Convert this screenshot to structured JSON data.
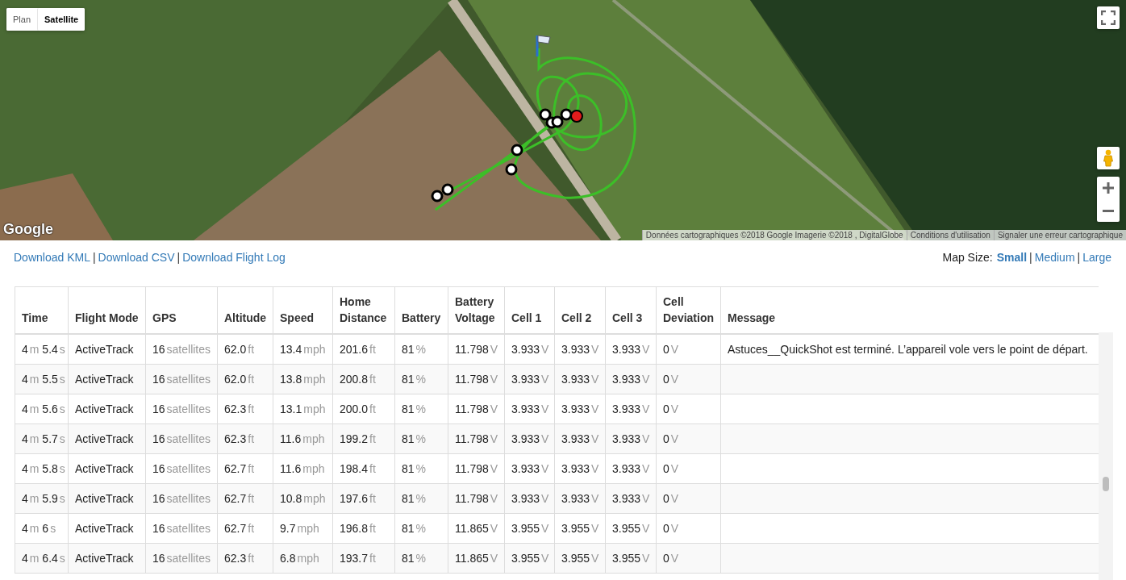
{
  "map": {
    "type_tabs": [
      {
        "label": "Plan",
        "selected": false
      },
      {
        "label": "Satellite",
        "selected": true
      }
    ],
    "logo": "Google",
    "attribution": [
      "Données cartographiques ©2018 Google Imagerie ©2018 , DigitalGlobe",
      "Conditions d'utilisation",
      "Signaler une erreur cartographique"
    ]
  },
  "downloads": [
    {
      "kind": "link",
      "text": "Download KML"
    },
    {
      "kind": "separator",
      "text": "|"
    },
    {
      "kind": "link",
      "text": "Download CSV"
    },
    {
      "kind": "separator",
      "text": "|"
    },
    {
      "kind": "link",
      "text": "Download Flight Log"
    }
  ],
  "map_size": {
    "label": "Map Size:",
    "options": [
      {
        "kind": "link",
        "text": "Small",
        "selected": true
      },
      {
        "kind": "separator",
        "text": "|"
      },
      {
        "kind": "link",
        "text": "Medium",
        "selected": false
      },
      {
        "kind": "separator",
        "text": "|"
      },
      {
        "kind": "link",
        "text": "Large",
        "selected": false
      }
    ]
  },
  "table": {
    "columns": [
      "Time",
      "Flight Mode",
      "GPS",
      "Altitude",
      "Speed",
      "Home Distance",
      "Battery",
      "Battery Voltage",
      "Cell 1",
      "Cell 2",
      "Cell 3",
      "Cell Deviation",
      "Message"
    ],
    "rows": [
      [
        [
          "4",
          "m",
          "5.4",
          "s"
        ],
        [
          "ActiveTrack"
        ],
        [
          "16",
          "satellites"
        ],
        [
          "62.0",
          "ft"
        ],
        [
          "13.4",
          "mph"
        ],
        [
          "201.6",
          "ft"
        ],
        [
          "81",
          "%"
        ],
        [
          "11.798",
          "V"
        ],
        [
          "3.933",
          "V"
        ],
        [
          "3.933",
          "V"
        ],
        [
          "3.933",
          "V"
        ],
        [
          "0",
          "V"
        ],
        [
          "Astuces__QuickShot est terminé. L’appareil vole vers le point de départ."
        ]
      ],
      [
        [
          "4",
          "m",
          "5.5",
          "s"
        ],
        [
          "ActiveTrack"
        ],
        [
          "16",
          "satellites"
        ],
        [
          "62.0",
          "ft"
        ],
        [
          "13.8",
          "mph"
        ],
        [
          "200.8",
          "ft"
        ],
        [
          "81",
          "%"
        ],
        [
          "11.798",
          "V"
        ],
        [
          "3.933",
          "V"
        ],
        [
          "3.933",
          "V"
        ],
        [
          "3.933",
          "V"
        ],
        [
          "0",
          "V"
        ],
        []
      ],
      [
        [
          "4",
          "m",
          "5.6",
          "s"
        ],
        [
          "ActiveTrack"
        ],
        [
          "16",
          "satellites"
        ],
        [
          "62.3",
          "ft"
        ],
        [
          "13.1",
          "mph"
        ],
        [
          "200.0",
          "ft"
        ],
        [
          "81",
          "%"
        ],
        [
          "11.798",
          "V"
        ],
        [
          "3.933",
          "V"
        ],
        [
          "3.933",
          "V"
        ],
        [
          "3.933",
          "V"
        ],
        [
          "0",
          "V"
        ],
        []
      ],
      [
        [
          "4",
          "m",
          "5.7",
          "s"
        ],
        [
          "ActiveTrack"
        ],
        [
          "16",
          "satellites"
        ],
        [
          "62.3",
          "ft"
        ],
        [
          "11.6",
          "mph"
        ],
        [
          "199.2",
          "ft"
        ],
        [
          "81",
          "%"
        ],
        [
          "11.798",
          "V"
        ],
        [
          "3.933",
          "V"
        ],
        [
          "3.933",
          "V"
        ],
        [
          "3.933",
          "V"
        ],
        [
          "0",
          "V"
        ],
        []
      ],
      [
        [
          "4",
          "m",
          "5.8",
          "s"
        ],
        [
          "ActiveTrack"
        ],
        [
          "16",
          "satellites"
        ],
        [
          "62.7",
          "ft"
        ],
        [
          "11.6",
          "mph"
        ],
        [
          "198.4",
          "ft"
        ],
        [
          "81",
          "%"
        ],
        [
          "11.798",
          "V"
        ],
        [
          "3.933",
          "V"
        ],
        [
          "3.933",
          "V"
        ],
        [
          "3.933",
          "V"
        ],
        [
          "0",
          "V"
        ],
        []
      ],
      [
        [
          "4",
          "m",
          "5.9",
          "s"
        ],
        [
          "ActiveTrack"
        ],
        [
          "16",
          "satellites"
        ],
        [
          "62.7",
          "ft"
        ],
        [
          "10.8",
          "mph"
        ],
        [
          "197.6",
          "ft"
        ],
        [
          "81",
          "%"
        ],
        [
          "11.798",
          "V"
        ],
        [
          "3.933",
          "V"
        ],
        [
          "3.933",
          "V"
        ],
        [
          "3.933",
          "V"
        ],
        [
          "0",
          "V"
        ],
        []
      ],
      [
        [
          "4",
          "m",
          "6",
          "s"
        ],
        [
          "ActiveTrack"
        ],
        [
          "16",
          "satellites"
        ],
        [
          "62.7",
          "ft"
        ],
        [
          "9.7",
          "mph"
        ],
        [
          "196.8",
          "ft"
        ],
        [
          "81",
          "%"
        ],
        [
          "11.865",
          "V"
        ],
        [
          "3.955",
          "V"
        ],
        [
          "3.955",
          "V"
        ],
        [
          "3.955",
          "V"
        ],
        [
          "0",
          "V"
        ],
        []
      ],
      [
        [
          "4",
          "m",
          "6.4",
          "s"
        ],
        [
          "ActiveTrack"
        ],
        [
          "16",
          "satellites"
        ],
        [
          "62.3",
          "ft"
        ],
        [
          "6.8",
          "mph"
        ],
        [
          "193.7",
          "ft"
        ],
        [
          "81",
          "%"
        ],
        [
          "11.865",
          "V"
        ],
        [
          "3.955",
          "V"
        ],
        [
          "3.955",
          "V"
        ],
        [
          "3.955",
          "V"
        ],
        [
          "0",
          "V"
        ],
        []
      ]
    ]
  }
}
